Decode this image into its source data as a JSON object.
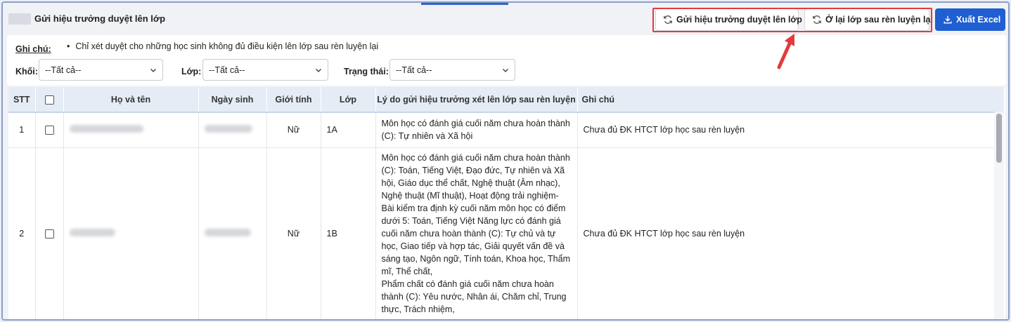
{
  "header": {
    "title": "Gửi hiệu trưởng duyệt lên lớp",
    "btn_send": "Gửi hiệu trưởng duyệt lên lớp",
    "btn_stay": "Ở lại lớp sau rèn luyện lại",
    "btn_excel": "Xuất Excel"
  },
  "filters": {
    "note_label": "Ghi chú",
    "note_suffix": ":",
    "note_text": "Chỉ xét duyệt cho những học sinh không đủ điều kiện lên lớp sau rèn luyện lại",
    "khoi_label": "Khối:",
    "khoi_value": "--Tất cả--",
    "lop_label": "Lớp:",
    "lop_value": "--Tất cả--",
    "trangthai_label": "Trạng thái:",
    "trangthai_value": "--Tất cả--"
  },
  "table": {
    "headers": {
      "stt": "STT",
      "name": "Họ và tên",
      "dob": "Ngày sinh",
      "gender": "Giới tính",
      "class": "Lớp",
      "reason": "Lý do gửi hiệu trưởng xét lên lớp sau rèn luyện",
      "note": "Ghi chú"
    },
    "rows": [
      {
        "stt": "1",
        "gender": "Nữ",
        "class": "1A",
        "reason": "Môn học có đánh giá cuối năm chưa hoàn thành (C): Tự nhiên và Xã hội",
        "note": "Chưa đủ ĐK HTCT lớp học sau rèn luyện"
      },
      {
        "stt": "2",
        "gender": "Nữ",
        "class": "1B",
        "reason": "Môn học có đánh giá cuối năm chưa hoàn thành (C): Toán, Tiếng Việt, Đạo đức, Tự nhiên và Xã hội, Giáo dục thể chất, Nghệ thuật (Âm nhạc), Nghệ thuật (Mĩ thuật), Hoạt động trải nghiệm- Bài kiểm tra định kỳ cuối năm môn học có điểm dưới 5: Toán, Tiếng Việt Năng lực có đánh giá cuối năm chưa hoàn thành (C): Tự chủ và tự học, Giao tiếp và hợp tác, Giải quyết vấn đề và sáng tạo, Ngôn ngữ, Tính toán, Khoa học, Thẩm mĩ, Thể chất,",
        "reason2": "Phẩm chất có đánh giá cuối năm chưa hoàn thành (C): Yêu nước, Nhân ái, Chăm chỉ, Trung thực, Trách nhiệm,",
        "note": "Chưa đủ ĐK HTCT lớp học sau rèn luyện"
      }
    ]
  },
  "colors": {
    "primary": "#1f5fd1",
    "highlight": "#e23b3b",
    "header_bg": "#e6ecf6"
  },
  "icons": {
    "refresh": "refresh-icon",
    "download": "download-icon",
    "chevron": "chevron-down-icon",
    "arrow": "red-arrow-icon"
  }
}
